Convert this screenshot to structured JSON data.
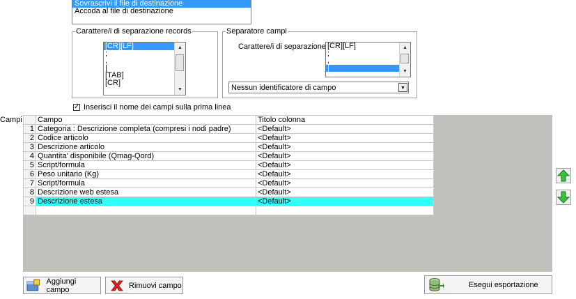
{
  "mode_list": {
    "items": [
      {
        "label": "Sovrascrivi il file di destinazione",
        "selected": true
      },
      {
        "label": "Accoda al file di destinazione",
        "selected": false
      }
    ]
  },
  "record_sep": {
    "legend": "Carattere/i di separazione records",
    "items": [
      {
        "label": "[CR][LF]",
        "selected": true
      },
      {
        "label": ";",
        "selected": false
      },
      {
        "label": ",",
        "selected": false
      },
      {
        "label": "|",
        "selected": false
      },
      {
        "label": "[TAB]",
        "selected": false
      },
      {
        "label": "[CR]",
        "selected": false
      }
    ]
  },
  "field_sep": {
    "legend": "Separatore campi",
    "label": "Carattere/i di separazione :",
    "items": [
      {
        "label": "[CR][LF]",
        "selected": false
      },
      {
        "label": ";",
        "selected": false
      },
      {
        "label": ",",
        "selected": false
      },
      {
        "label": "|",
        "selected": true
      }
    ],
    "identifier_value": "Nessun identificatore di campo"
  },
  "header_checkbox": {
    "label": "Inserisci il nome dei campi sulla prima linea",
    "checked": true
  },
  "fields": {
    "label": "Campi :",
    "columns": [
      "Campo",
      "Titolo colonna"
    ],
    "rows": [
      {
        "n": "1",
        "campo": "Categoria : Descrizione completa (compresi i nodi padre)",
        "titolo": "<Default>"
      },
      {
        "n": "2",
        "campo": "Codice articolo",
        "titolo": "<Default>"
      },
      {
        "n": "3",
        "campo": "Descrizione articolo",
        "titolo": "<Default>"
      },
      {
        "n": "4",
        "campo": "Quantita' disponibile (Qmag-Qord)",
        "titolo": "<Default>"
      },
      {
        "n": "5",
        "campo": "Script/formula",
        "titolo": "<Default>"
      },
      {
        "n": "6",
        "campo": "Peso unitario (Kg)",
        "titolo": "<Default>"
      },
      {
        "n": "7",
        "campo": "Script/formula",
        "titolo": "<Default>"
      },
      {
        "n": "8",
        "campo": "Descrizione web estesa",
        "titolo": "<Default>"
      },
      {
        "n": "9",
        "campo": "Descrizione estesa",
        "titolo": "<Default>"
      }
    ],
    "selected_row": 9
  },
  "buttons": {
    "add": "Aggiungi campo",
    "remove": "Rimuovi campo",
    "export": "Esegui esportazione"
  },
  "icons": {
    "up": "arrow-up-icon",
    "down": "arrow-down-icon",
    "add": "add-field-icon",
    "remove": "remove-x-icon",
    "export": "export-database-icon"
  },
  "colors": {
    "selection": "#3399ff",
    "grid_selected_row": "#33ffff",
    "grid_background": "#c0c0bc",
    "arrow_green": "#22aa22"
  }
}
